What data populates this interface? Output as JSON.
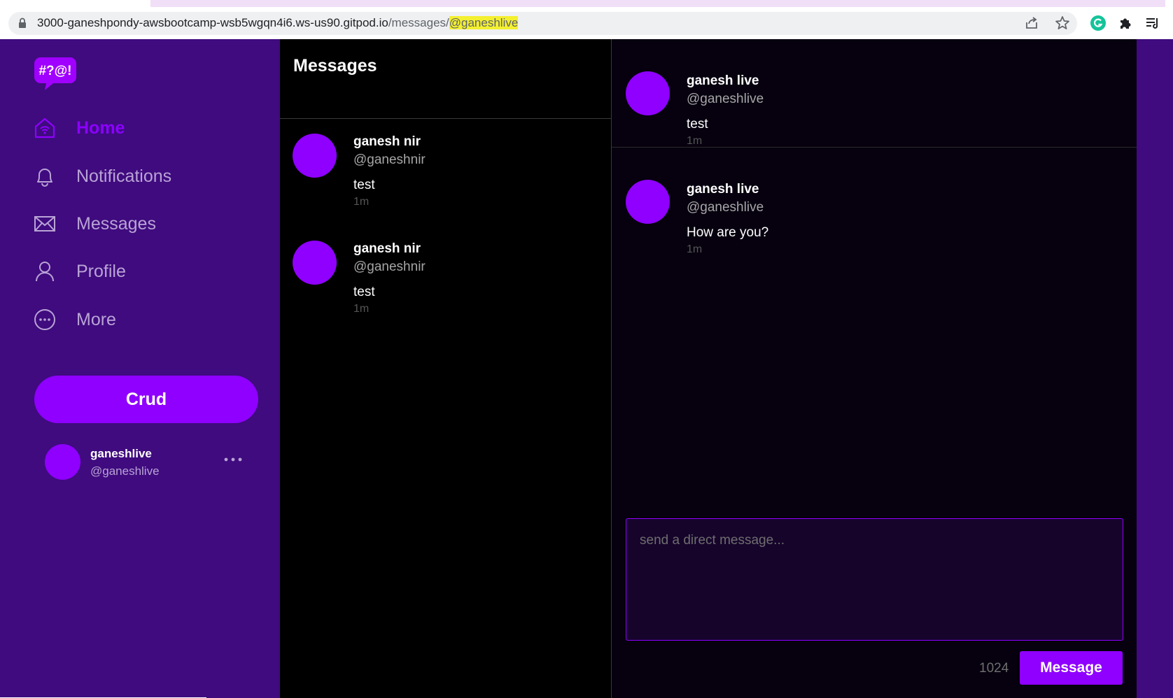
{
  "browser": {
    "url_host": "3000-ganeshpondy-awsbootcamp-wsb5wgqn4i6.ws-us90.gitpod.io",
    "url_path": "/messages/",
    "url_highlight": "@ganeshlive",
    "icons": [
      "lock-icon",
      "share-icon",
      "star-icon",
      "grammarly-icon",
      "extensions-icon",
      "reading-list-icon"
    ]
  },
  "sidebar": {
    "logo_text": "#?@!",
    "nav": [
      {
        "label": "Home",
        "icon": "home-icon",
        "active": true
      },
      {
        "label": "Notifications",
        "icon": "bell-icon",
        "active": false
      },
      {
        "label": "Messages",
        "icon": "envelope-icon",
        "active": false
      },
      {
        "label": "Profile",
        "icon": "person-icon",
        "active": false
      },
      {
        "label": "More",
        "icon": "more-circle-icon",
        "active": false
      }
    ],
    "crud_label": "Crud",
    "user": {
      "display_name": "ganeshlive",
      "handle": "@ganeshlive"
    }
  },
  "messages_list": {
    "title": "Messages",
    "groups": [
      {
        "name": "ganesh nir",
        "handle": "@ganeshnir",
        "text": "test",
        "time": "1m"
      },
      {
        "name": "ganesh nir",
        "handle": "@ganeshnir",
        "text": "test",
        "time": "1m"
      }
    ]
  },
  "conversation": {
    "messages": [
      {
        "name": "ganesh live",
        "handle": "@ganeshlive",
        "text": "test",
        "time": "1m"
      },
      {
        "name": "ganesh live",
        "handle": "@ganeshlive",
        "text": "How are you?",
        "time": "1m"
      }
    ],
    "input_placeholder": "send a direct message...",
    "char_count": "1024",
    "send_label": "Message"
  },
  "colors": {
    "sidebar_bg": "#3f0b7e",
    "accent": "#8f00ff",
    "list_bg": "#000000",
    "convo_bg": "#07000f",
    "url_highlight": "#f4f030"
  }
}
